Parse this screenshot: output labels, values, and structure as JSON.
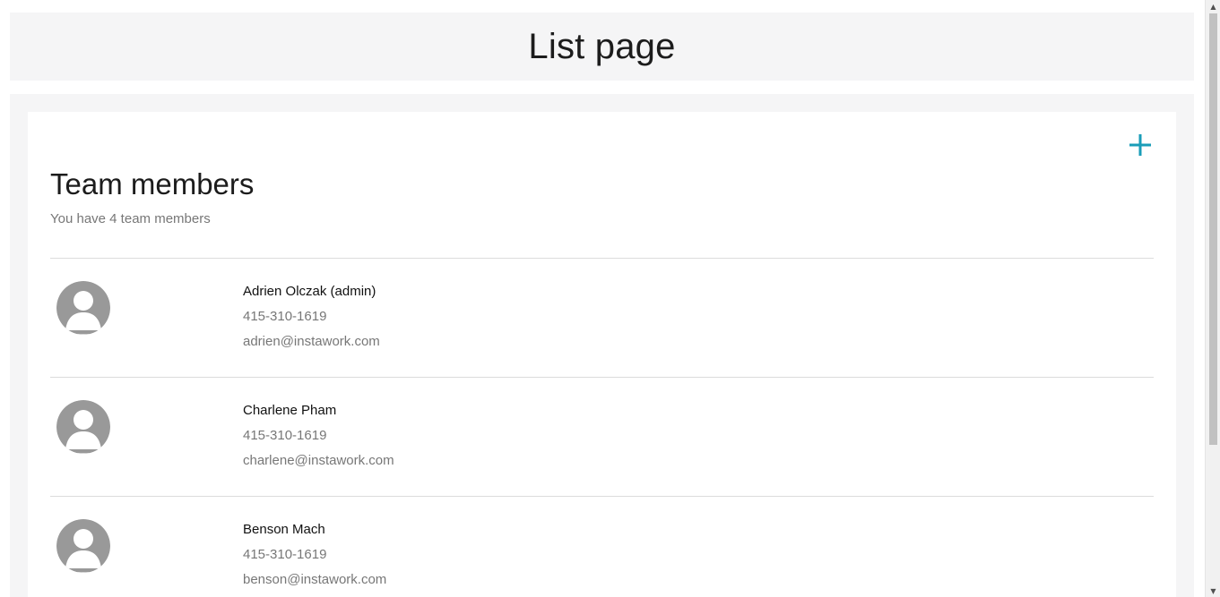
{
  "header": {
    "title": "List page"
  },
  "team": {
    "title": "Team members",
    "subtitle": "You have 4 team members",
    "add_icon": "plus-icon",
    "accent_color": "#1a9db8",
    "members": [
      {
        "name": "Adrien Olczak (admin)",
        "phone": "415-310-1619",
        "email": "adrien@instawork.com",
        "avatar_icon": "default-avatar-icon"
      },
      {
        "name": "Charlene Pham",
        "phone": "415-310-1619",
        "email": "charlene@instawork.com",
        "avatar_icon": "default-avatar-icon"
      },
      {
        "name": "Benson Mach",
        "phone": "415-310-1619",
        "email": "benson@instawork.com",
        "avatar_icon": "default-avatar-icon"
      }
    ]
  },
  "scrollbar": {
    "up_arrow": "▲",
    "down_arrow": "▼"
  }
}
